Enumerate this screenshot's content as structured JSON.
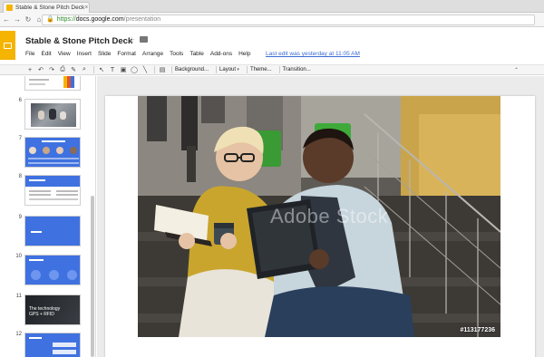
{
  "browser": {
    "tab_title": "Stable & Stone Pitch Deck",
    "tab_close": "×",
    "url_scheme": "https://",
    "url_host": "docs.google.com",
    "url_path": "/presentation",
    "accent_green": "#2e8b2e"
  },
  "app": {
    "title": "Stable & Stone Pitch Deck",
    "brand_color": "#f4b400",
    "menu": [
      "File",
      "Edit",
      "View",
      "Insert",
      "Slide",
      "Format",
      "Arrange",
      "Tools",
      "Table",
      "Add-ons",
      "Help"
    ],
    "last_edit": "Last edit was yesterday at 11:05 AM"
  },
  "toolbar": {
    "background_label": "Background...",
    "layout_label": "Layout",
    "theme_label": "Theme...",
    "transition_label": "Transition...",
    "icons": [
      "add-icon",
      "undo-icon",
      "redo-icon",
      "print-icon",
      "paint-format-icon",
      "zoom-icon",
      "select-icon",
      "textbox-icon",
      "image-icon",
      "shape-icon",
      "line-icon",
      "comment-icon"
    ]
  },
  "filmstrip": {
    "slides": [
      {
        "number": "6",
        "style": "photo"
      },
      {
        "number": "7",
        "style": "team"
      },
      {
        "number": "8",
        "style": "text"
      },
      {
        "number": "9",
        "style": "blue"
      },
      {
        "number": "10",
        "style": "circles"
      },
      {
        "number": "11",
        "style": "dark",
        "text_line1": "The technology",
        "text_line2": "GPS + RFID"
      },
      {
        "number": "12",
        "style": "boxes"
      }
    ]
  },
  "canvas": {
    "watermark": "Adobe Stock",
    "stock_id": "#113177236"
  }
}
